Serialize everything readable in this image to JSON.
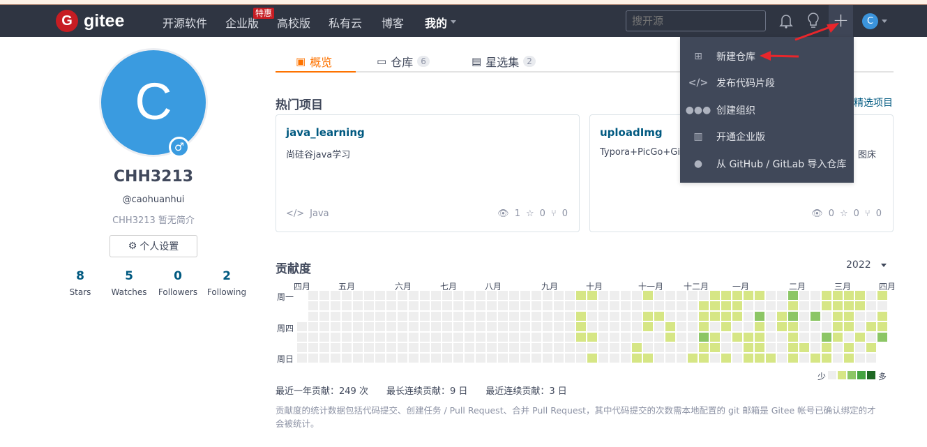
{
  "header": {
    "logo": "gitee",
    "logo_letter": "G",
    "nav": [
      "开源软件",
      "企业版",
      "高校版",
      "私有云",
      "博客",
      "我的"
    ],
    "promo_badge": "特惠",
    "search_placeholder": "搜开源",
    "avatar_letter": "C"
  },
  "create_menu": {
    "items": [
      {
        "icon": "plus-square-icon",
        "label": "新建仓库"
      },
      {
        "icon": "code-icon",
        "label": "发布代码片段"
      },
      {
        "icon": "group-icon",
        "label": "创建组织"
      },
      {
        "icon": "building-icon",
        "label": "开通企业版"
      },
      {
        "icon": "github-icon",
        "label": "从 GitHub / GitLab 导入仓库"
      }
    ]
  },
  "profile": {
    "avatar_letter": "C",
    "name": "CHH3213",
    "username": "@caohuanhui",
    "bio": "CHH3213 暂无简介",
    "settings_label": "个人设置",
    "stats": [
      {
        "value": "8",
        "label": "Stars"
      },
      {
        "value": "5",
        "label": "Watches"
      },
      {
        "value": "0",
        "label": "Followers"
      },
      {
        "value": "2",
        "label": "Following"
      }
    ]
  },
  "tabs": [
    {
      "label": "概览",
      "count": null,
      "active": true
    },
    {
      "label": "仓库",
      "count": "6"
    },
    {
      "label": "星选集",
      "count": "2"
    }
  ],
  "hot": {
    "title": "热门项目",
    "link": "精选项目",
    "cards": [
      {
        "name": "java_learning",
        "desc": "尚硅谷java学习",
        "lang": "Java",
        "watch": "1",
        "star": "0",
        "fork": "0"
      },
      {
        "name": "uploadImg",
        "desc": "Typora+PicGo+Git",
        "desc_tail": "图床",
        "lang": "",
        "watch": "0",
        "star": "0",
        "fork": "0"
      }
    ]
  },
  "contrib": {
    "title": "贡献度",
    "year": "2022",
    "months": [
      "四月",
      "五月",
      "六月",
      "七月",
      "八月",
      "九月",
      "十月",
      "十一月",
      "十二月",
      "一月",
      "二月",
      "三月",
      "四月"
    ],
    "weekdays": [
      "周一",
      "周四",
      "周日"
    ],
    "legend_less": "少",
    "legend_more": "多",
    "colors": [
      "#eeeeee",
      "#d6e685",
      "#8cc665",
      "#44a340",
      "#1e6823"
    ],
    "levels_by_week": [
      [
        null,
        null,
        null,
        0,
        0,
        0,
        0
      ],
      [
        0,
        0,
        0,
        0,
        0,
        0,
        0
      ],
      [
        0,
        0,
        0,
        0,
        0,
        0,
        0
      ],
      [
        0,
        0,
        0,
        0,
        0,
        0,
        0
      ],
      [
        0,
        0,
        0,
        0,
        0,
        0,
        0
      ],
      [
        0,
        0,
        0,
        0,
        0,
        0,
        0
      ],
      [
        0,
        0,
        0,
        0,
        0,
        0,
        0
      ],
      [
        0,
        0,
        0,
        0,
        0,
        0,
        0
      ],
      [
        0,
        0,
        0,
        0,
        0,
        0,
        0
      ],
      [
        0,
        0,
        0,
        0,
        0,
        0,
        0
      ],
      [
        0,
        0,
        0,
        0,
        0,
        0,
        0
      ],
      [
        0,
        0,
        0,
        0,
        0,
        0,
        0
      ],
      [
        0,
        0,
        0,
        0,
        0,
        0,
        0
      ],
      [
        0,
        0,
        0,
        0,
        0,
        0,
        0
      ],
      [
        0,
        0,
        0,
        0,
        0,
        0,
        0
      ],
      [
        0,
        0,
        0,
        0,
        0,
        0,
        0
      ],
      [
        0,
        0,
        0,
        0,
        0,
        0,
        0
      ],
      [
        0,
        0,
        0,
        0,
        0,
        0,
        0
      ],
      [
        0,
        0,
        0,
        0,
        0,
        0,
        0
      ],
      [
        0,
        0,
        0,
        0,
        0,
        0,
        0
      ],
      [
        0,
        0,
        0,
        0,
        0,
        0,
        0
      ],
      [
        0,
        0,
        0,
        0,
        0,
        0,
        0
      ],
      [
        0,
        0,
        0,
        0,
        0,
        0,
        0
      ],
      [
        0,
        0,
        0,
        0,
        0,
        0,
        0
      ],
      [
        0,
        0,
        0,
        0,
        0,
        0,
        0
      ],
      [
        1,
        0,
        1,
        1,
        1,
        0,
        0
      ],
      [
        1,
        0,
        0,
        0,
        1,
        0,
        1
      ],
      [
        0,
        0,
        0,
        0,
        0,
        0,
        0
      ],
      [
        0,
        0,
        0,
        0,
        0,
        0,
        0
      ],
      [
        0,
        0,
        0,
        0,
        0,
        0,
        0
      ],
      [
        0,
        0,
        0,
        0,
        0,
        1,
        1
      ],
      [
        1,
        0,
        1,
        1,
        0,
        0,
        1
      ],
      [
        0,
        0,
        1,
        0,
        0,
        0,
        0
      ],
      [
        0,
        0,
        0,
        1,
        1,
        0,
        0
      ],
      [
        0,
        0,
        0,
        0,
        0,
        0,
        0
      ],
      [
        0,
        0,
        0,
        0,
        0,
        0,
        1
      ],
      [
        0,
        1,
        1,
        1,
        2,
        1,
        1
      ],
      [
        1,
        1,
        1,
        0,
        1,
        1,
        0
      ],
      [
        1,
        1,
        1,
        1,
        0,
        0,
        1
      ],
      [
        1,
        1,
        1,
        0,
        1,
        0,
        0
      ],
      [
        1,
        0,
        0,
        0,
        1,
        1,
        1
      ],
      [
        1,
        0,
        2,
        1,
        1,
        1,
        1
      ],
      [
        0,
        0,
        0,
        0,
        0,
        0,
        1
      ],
      [
        0,
        0,
        1,
        1,
        0,
        0,
        0
      ],
      [
        2,
        1,
        2,
        1,
        1,
        1,
        1
      ],
      [
        0,
        0,
        0,
        0,
        0,
        1,
        0
      ],
      [
        0,
        0,
        2,
        0,
        0,
        0,
        1
      ],
      [
        1,
        1,
        0,
        0,
        2,
        1,
        1
      ],
      [
        1,
        1,
        1,
        1,
        1,
        0,
        0
      ],
      [
        1,
        1,
        1,
        1,
        0,
        1,
        1
      ],
      [
        1,
        1,
        0,
        0,
        1,
        0,
        0
      ],
      [
        0,
        0,
        0,
        1,
        0,
        1,
        0
      ],
      [
        1,
        0,
        1,
        1,
        2,
        null,
        null
      ]
    ],
    "summary": [
      {
        "label": "最近一年贡献：",
        "value": "249 次"
      },
      {
        "label": "最长连续贡献：",
        "value": "9 日"
      },
      {
        "label": "最近连续贡献：",
        "value": "3 日"
      }
    ],
    "note": "贡献度的统计数据包括代码提交、创建任务 / Pull Request、合并 Pull Request，其中代码提交的次数需本地配置的 git 邮箱是 Gitee 帐号已确认绑定的才会被统计。"
  }
}
